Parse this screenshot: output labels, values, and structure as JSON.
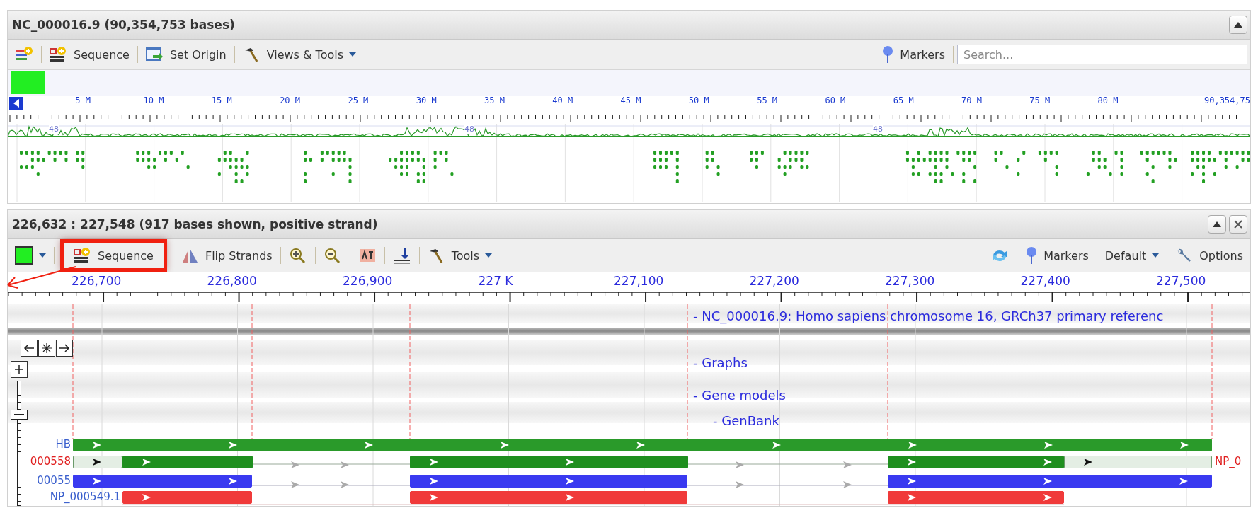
{
  "overview_panel": {
    "title": "NC_000016.9 (90,354,753 bases)",
    "toolbar_left": [
      {
        "kind": "add-track"
      },
      {
        "kind": "sequence",
        "label": "Sequence"
      },
      {
        "kind": "set-origin",
        "label": "Set Origin"
      },
      {
        "kind": "tools",
        "label": "Views & Tools",
        "dropdown": true
      }
    ],
    "toolbar_right": [
      {
        "kind": "markers",
        "label": "Markers"
      }
    ],
    "search": {
      "placeholder": "Search..."
    },
    "ruler_labels": [
      "5 M",
      "10 M",
      "15 M",
      "20 M",
      "25 M",
      "30 M",
      "35 M",
      "40 M",
      "45 M",
      "50 M",
      "55 M",
      "60 M",
      "65 M",
      "70 M",
      "75 M",
      "80 M",
      "90,354,75"
    ],
    "graph_marks": [
      "48",
      "48",
      "48"
    ]
  },
  "detail_panel": {
    "title": "226,632 : 227,548 (917 bases shown, positive strand)",
    "toolbar_left": [
      {
        "kind": "color",
        "dropdown": true
      },
      {
        "kind": "sequence",
        "label": "Sequence",
        "highlighted": true
      },
      {
        "kind": "flip",
        "label": "Flip Strands"
      },
      {
        "kind": "zoom-in"
      },
      {
        "kind": "zoom-out"
      },
      {
        "kind": "translate"
      },
      {
        "kind": "export"
      },
      {
        "kind": "tools",
        "label": "Tools",
        "dropdown": true
      }
    ],
    "toolbar_right": [
      {
        "kind": "refresh"
      },
      {
        "kind": "markers",
        "label": "Markers"
      },
      {
        "kind": "layout",
        "label": "Default",
        "dropdown": true
      },
      {
        "kind": "options",
        "label": "Options"
      }
    ],
    "ruler_labels": [
      "226,700",
      "226,800",
      "226,900",
      "227 K",
      "227,100",
      "227,200",
      "227,300",
      "227,400",
      "227,500"
    ],
    "tracks": [
      {
        "label": "- NC_000016.9: Homo sapiens chromosome 16, GRCh37 primary referenc"
      },
      {
        "label": "- Graphs"
      },
      {
        "label": "- Gene models",
        "children": [
          {
            "label": "- GenBank"
          }
        ]
      }
    ],
    "zoom_slider": {
      "level": 0.75
    },
    "features": [
      {
        "label": "HB",
        "color": "#2a9a2a",
        "selected": false
      },
      {
        "label": "000558",
        "color": "#1f8f1f",
        "selected": true,
        "right_label": "NP_0"
      },
      {
        "label": "00055",
        "color": "#3a3af0",
        "selected": false
      },
      {
        "label": "NP_000549.1",
        "color": "#f03a3a",
        "selected": false
      }
    ]
  }
}
